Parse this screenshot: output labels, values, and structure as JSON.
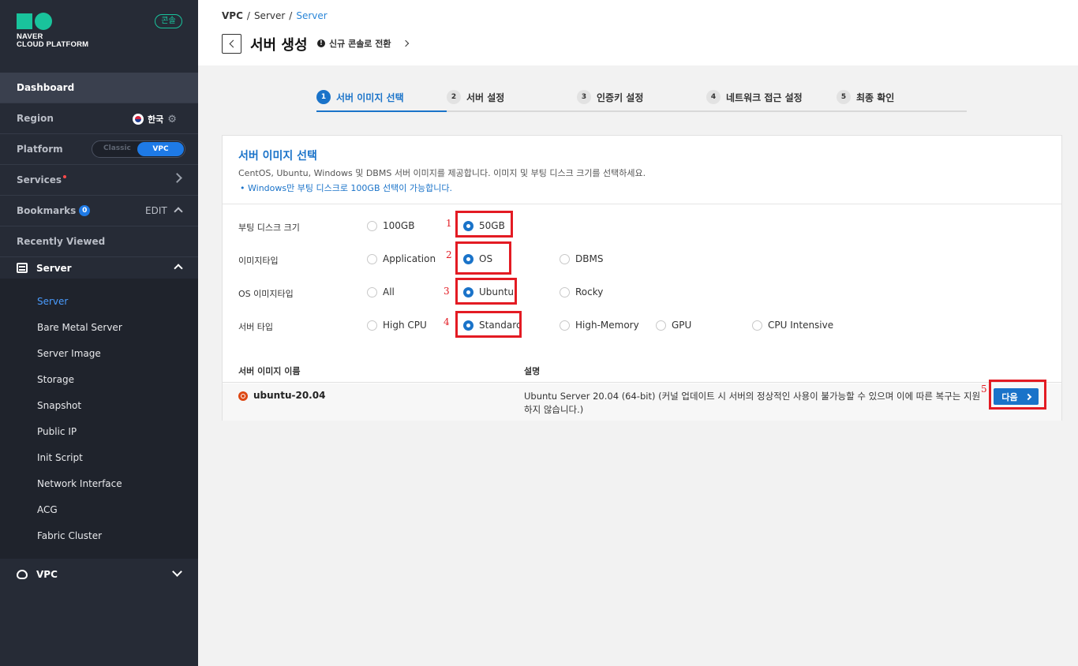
{
  "sidebar": {
    "logo_line1": "NAVER",
    "logo_line2": "CLOUD PLATFORM",
    "console_badge": "콘솔",
    "dashboard": "Dashboard",
    "region_label": "Region",
    "region_value": "한국",
    "platform_label": "Platform",
    "platform_classic": "Classic",
    "platform_vpc": "VPC",
    "services": "Services",
    "bookmarks": "Bookmarks",
    "bookmarks_count": "0",
    "edit": "EDIT",
    "recently_viewed": "Recently Viewed",
    "server": "Server",
    "sub_items": [
      "Server",
      "Bare Metal Server",
      "Server Image",
      "Storage",
      "Snapshot",
      "Public IP",
      "Init Script",
      "Network Interface",
      "ACG",
      "Fabric Cluster"
    ],
    "vpc": "VPC"
  },
  "header": {
    "breadcrumb": [
      "VPC",
      "Server",
      "Server"
    ],
    "title": "서버 생성",
    "switch_link": "신규 콘솔로 전환"
  },
  "steps": [
    {
      "num": "1",
      "label": "서버 이미지 선택"
    },
    {
      "num": "2",
      "label": "서버 설정"
    },
    {
      "num": "3",
      "label": "인증키 설정"
    },
    {
      "num": "4",
      "label": "네트워크 접근 설정"
    },
    {
      "num": "5",
      "label": "최종 확인"
    }
  ],
  "panel": {
    "title": "서버 이미지 선택",
    "desc": "CentOS, Ubuntu, Windows 및 DBMS 서버 이미지를 제공합니다. 이미지 및 부팅 디스크 크기를 선택하세요.",
    "note": "Windows만 부팅 디스크로 100GB 선택이 가능합니다.",
    "options": {
      "boot_disk": {
        "label": "부팅 디스크 크기",
        "choices": [
          "100GB",
          "50GB"
        ],
        "selected": "50GB"
      },
      "image_type": {
        "label": "이미지타입",
        "choices": [
          "Application",
          "OS",
          "DBMS"
        ],
        "selected": "OS"
      },
      "os_image_type": {
        "label": "OS 이미지타입",
        "choices": [
          "All",
          "Ubuntu",
          "Rocky"
        ],
        "selected": "Ubuntu"
      },
      "server_type": {
        "label": "서버 타입",
        "choices": [
          "High CPU",
          "Standard",
          "High-Memory",
          "GPU",
          "CPU Intensive"
        ],
        "selected": "Standard"
      }
    },
    "table": {
      "col_name": "서버 이미지 이름",
      "col_desc": "설명",
      "row_name": "ubuntu-20.04",
      "row_desc": "Ubuntu Server 20.04 (64-bit) (커널 업데이트 시 서버의 정상적인 사용이 불가능할 수 있으며 이에 따른 복구는 지원하지 않습니다.)"
    },
    "next_button": "다음"
  },
  "annotations": [
    "1",
    "2",
    "3",
    "4",
    "5"
  ],
  "colors": {
    "accent": "#1a73c9",
    "highlight": "#e31b23",
    "sidebar_bg": "#262b36",
    "brand": "#19c39c"
  }
}
